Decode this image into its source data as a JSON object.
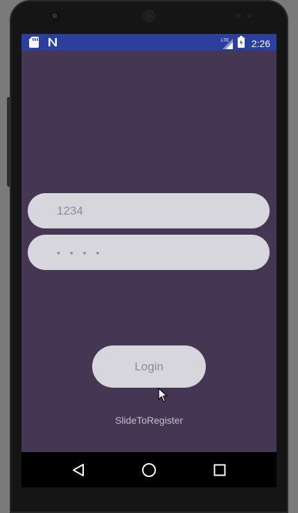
{
  "status_bar": {
    "left_icons": [
      "sd-card-icon",
      "n-notification-icon"
    ],
    "right_icons": [
      "lte-signal-icon",
      "battery-icon"
    ],
    "network_label": "LTE",
    "time": "2:26",
    "background_color": "#2c3f9d"
  },
  "screen": {
    "background_color": "#453753"
  },
  "login_form": {
    "username_value": "1234",
    "password_value": "• • • •",
    "login_label": "Login",
    "register_link": "SlideToRegister",
    "field_color": "#d8d6dd",
    "field_text_color": "#8d8996"
  },
  "nav_bar": {
    "icons": [
      "back-icon",
      "home-icon",
      "recents-icon"
    ]
  }
}
